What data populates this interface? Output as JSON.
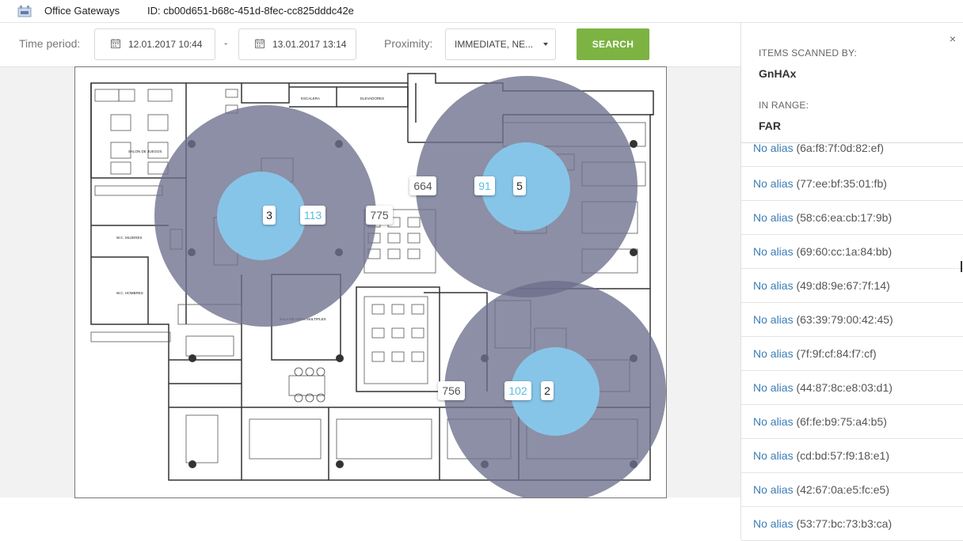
{
  "header": {
    "title": "Office Gateways",
    "id_text": "ID: cb00d651-b68c-451d-8fec-cc825dddc42e"
  },
  "filters": {
    "time_period_label": "Time period:",
    "date_from": "12.01.2017 10:44",
    "separator": "-",
    "date_to": "13.01.2017 13:14",
    "proximity_label": "Proximity:",
    "proximity_value": "IMMEDIATE, NE...",
    "search_label": "SEARCH"
  },
  "map": {
    "gateways": [
      {
        "count_far": "775",
        "count_near": "113",
        "count_immediate": "3"
      },
      {
        "count_far": "664",
        "count_near": "91",
        "count_immediate": "5"
      },
      {
        "count_far": "756",
        "count_near": "102",
        "count_immediate": "2"
      }
    ],
    "room_labels": {
      "escalera": "ESCALERA",
      "elevadores": "ELEVADORES",
      "salon_juegos": "SALON DE JUEGOS",
      "wc_mujeres": "W.C. MUJERES",
      "wc_hombres": "W.C. HOMBRES",
      "sala_usos": "SALA DE USOS MULTIPLES"
    },
    "colors": {
      "far_ring": "#6b6f8c",
      "near_ring": "#87c5e8"
    }
  },
  "panel": {
    "close_label": "×",
    "scanned_by_label": "ITEMS SCANNED BY:",
    "scanned_by_value": "GnHAx",
    "in_range_label": "IN RANGE:",
    "in_range_value": "FAR",
    "items": [
      {
        "alias": "No alias",
        "mac": "(6a:f8:7f:0d:82:ef)"
      },
      {
        "alias": "No alias",
        "mac": "(77:ee:bf:35:01:fb)"
      },
      {
        "alias": "No alias",
        "mac": "(58:c6:ea:cb:17:9b)"
      },
      {
        "alias": "No alias",
        "mac": "(69:60:cc:1a:84:bb)"
      },
      {
        "alias": "No alias",
        "mac": "(49:d8:9e:67:7f:14)"
      },
      {
        "alias": "No alias",
        "mac": "(63:39:79:00:42:45)"
      },
      {
        "alias": "No alias",
        "mac": "(7f:9f:cf:84:f7:cf)"
      },
      {
        "alias": "No alias",
        "mac": "(44:87:8c:e8:03:d1)"
      },
      {
        "alias": "No alias",
        "mac": "(6f:fe:b9:75:a4:b5)"
      },
      {
        "alias": "No alias",
        "mac": "(cd:bd:57:f9:18:e1)"
      },
      {
        "alias": "No alias",
        "mac": "(42:67:0a:e5:fc:e5)"
      },
      {
        "alias": "No alias",
        "mac": "(53:77:bc:73:b3:ca)"
      }
    ]
  }
}
